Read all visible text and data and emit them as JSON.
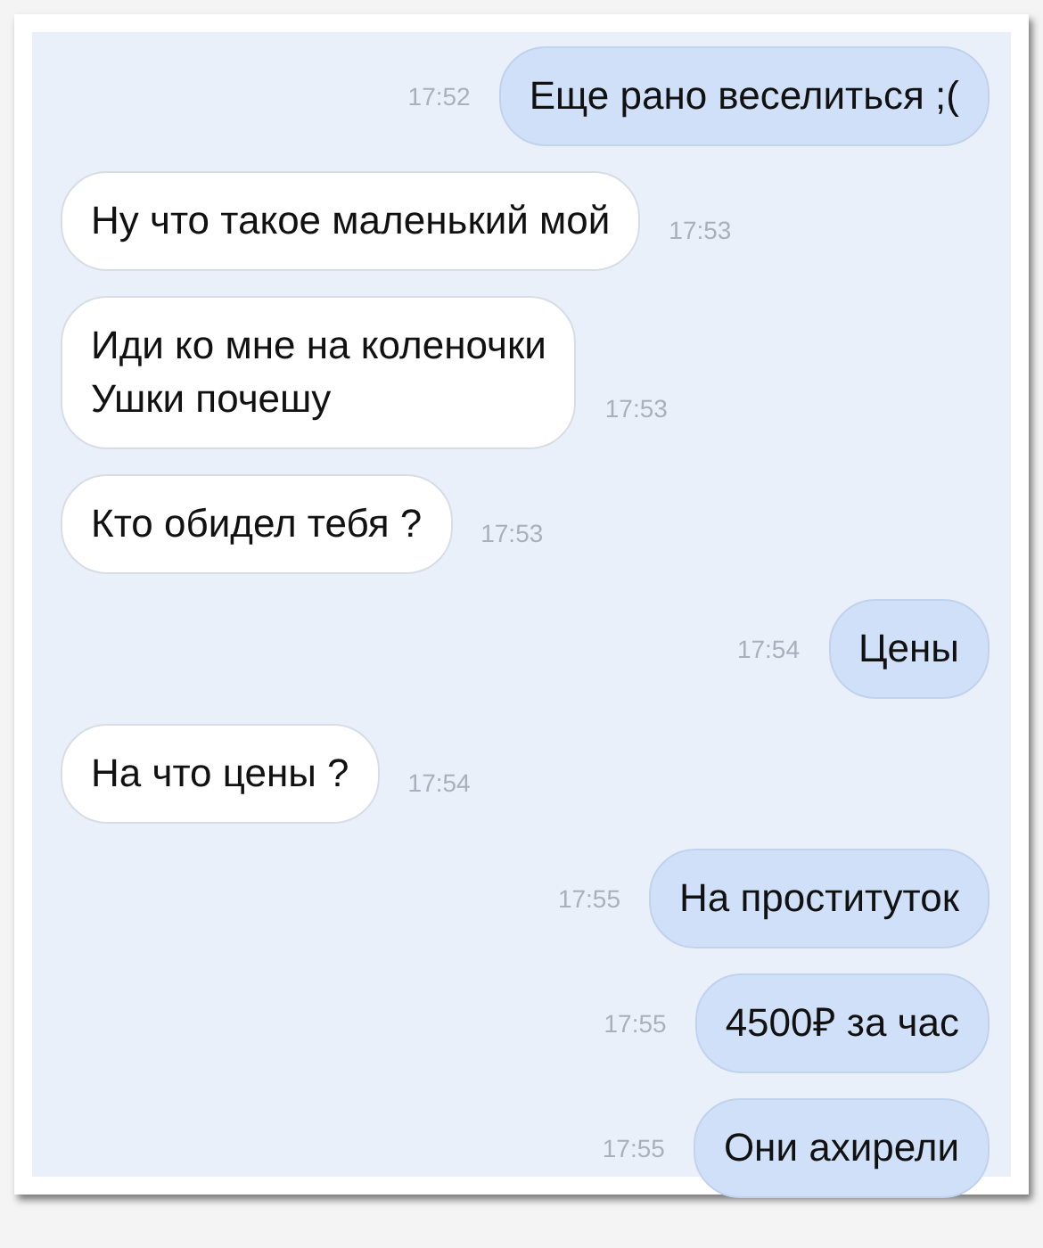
{
  "messages": [
    {
      "kind": "outgoing",
      "text": "Еще рано веселиться ;(",
      "time": "17:52"
    },
    {
      "kind": "incoming",
      "text": "Ну что такое маленький мой",
      "time": "17:53"
    },
    {
      "kind": "incoming",
      "text": "Иди ко мне на коленочки\nУшки почешу",
      "time": "17:53"
    },
    {
      "kind": "incoming",
      "text": "Кто обидел тебя ?",
      "time": "17:53"
    },
    {
      "kind": "outgoing",
      "text": "Цены",
      "time": "17:54"
    },
    {
      "kind": "incoming",
      "text": "На что цены ?",
      "time": "17:54"
    },
    {
      "kind": "outgoing",
      "text": "На проституток",
      "time": "17:55"
    },
    {
      "kind": "outgoing",
      "text": "4500₽ за час",
      "time": "17:55"
    },
    {
      "kind": "outgoing",
      "text": "Они ахирели",
      "time": "17:55"
    }
  ]
}
